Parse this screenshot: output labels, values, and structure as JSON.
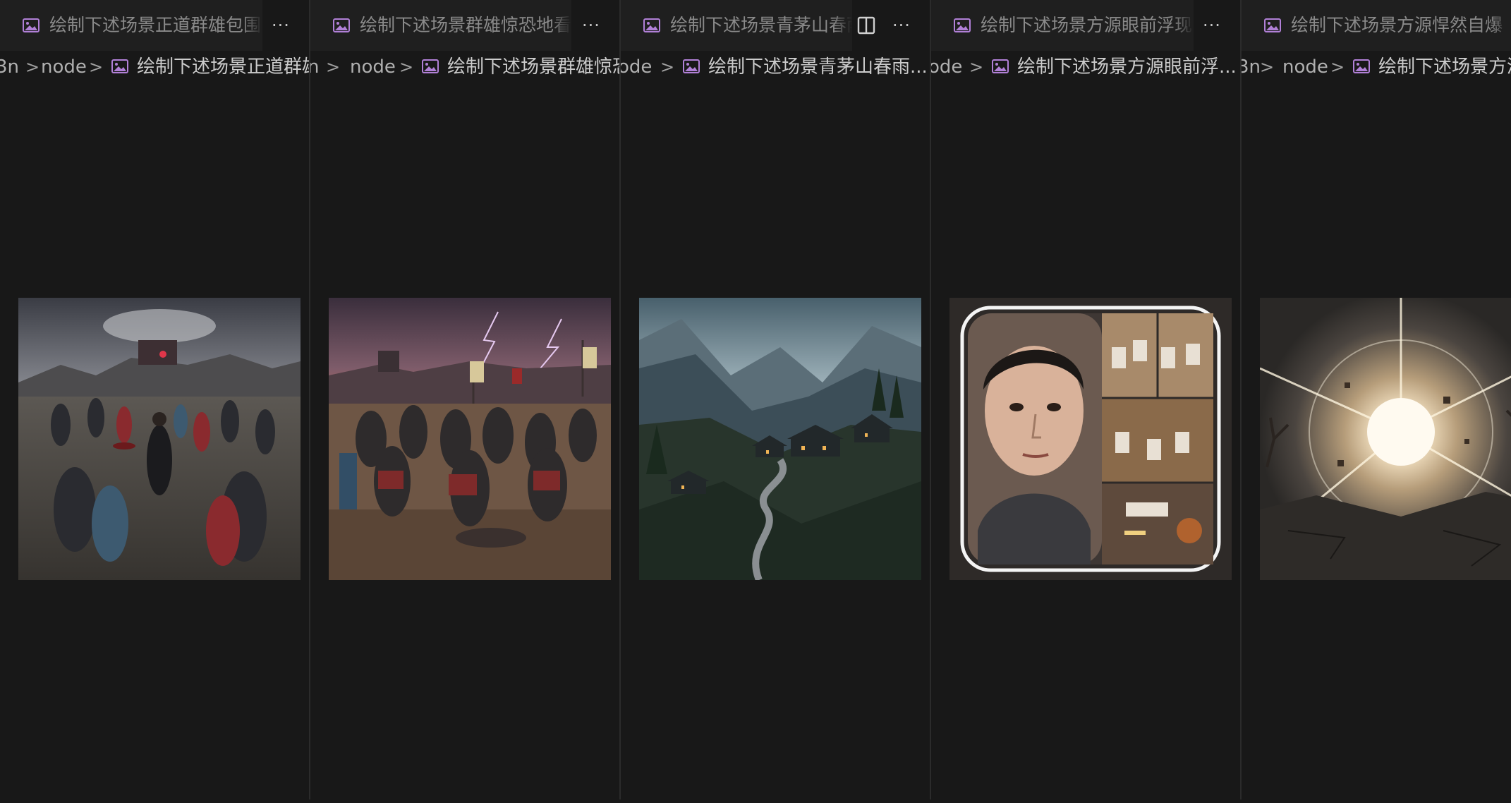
{
  "groups": [
    {
      "tab_title": "绘制下述场景正道群雄包围",
      "crumb_folder": "3n",
      "crumb_node": "node",
      "crumb_file": "绘制下述场景正道群雄",
      "image_icon": "image-file-icon"
    },
    {
      "tab_title": "绘制下述场景群雄惊恐地看",
      "crumb_folder": "n",
      "crumb_node": "node",
      "crumb_file": "绘制下述场景群雄惊恐",
      "image_icon": "image-file-icon"
    },
    {
      "tab_title": "绘制下述场景青茅山春雨",
      "crumb_folder": "ode",
      "crumb_node": "",
      "crumb_file": "绘制下述场景青茅山春雨...",
      "image_icon": "image-file-icon"
    },
    {
      "tab_title": "绘制下述场景方源眼前浮现",
      "crumb_folder": "ode",
      "crumb_node": "",
      "crumb_file": "绘制下述场景方源眼前浮...",
      "image_icon": "image-file-icon"
    },
    {
      "tab_title": "绘制下述场景方源悍然自爆",
      "crumb_folder": "3n",
      "crumb_node": "node",
      "crumb_file": "绘制下述场景方源",
      "image_icon": "image-file-icon"
    }
  ],
  "tab_more_label": "···",
  "crumb_separator": ">",
  "colors": {
    "background": "#181818",
    "tab_background": "#1f1f1f",
    "image_icon": "#b180d7",
    "border": "#2b2b2b"
  },
  "icons": {
    "file": "image-file-icon",
    "more": "more-actions-icon",
    "split": "split-editor-icon",
    "chevron": "chevron-right-icon"
  }
}
